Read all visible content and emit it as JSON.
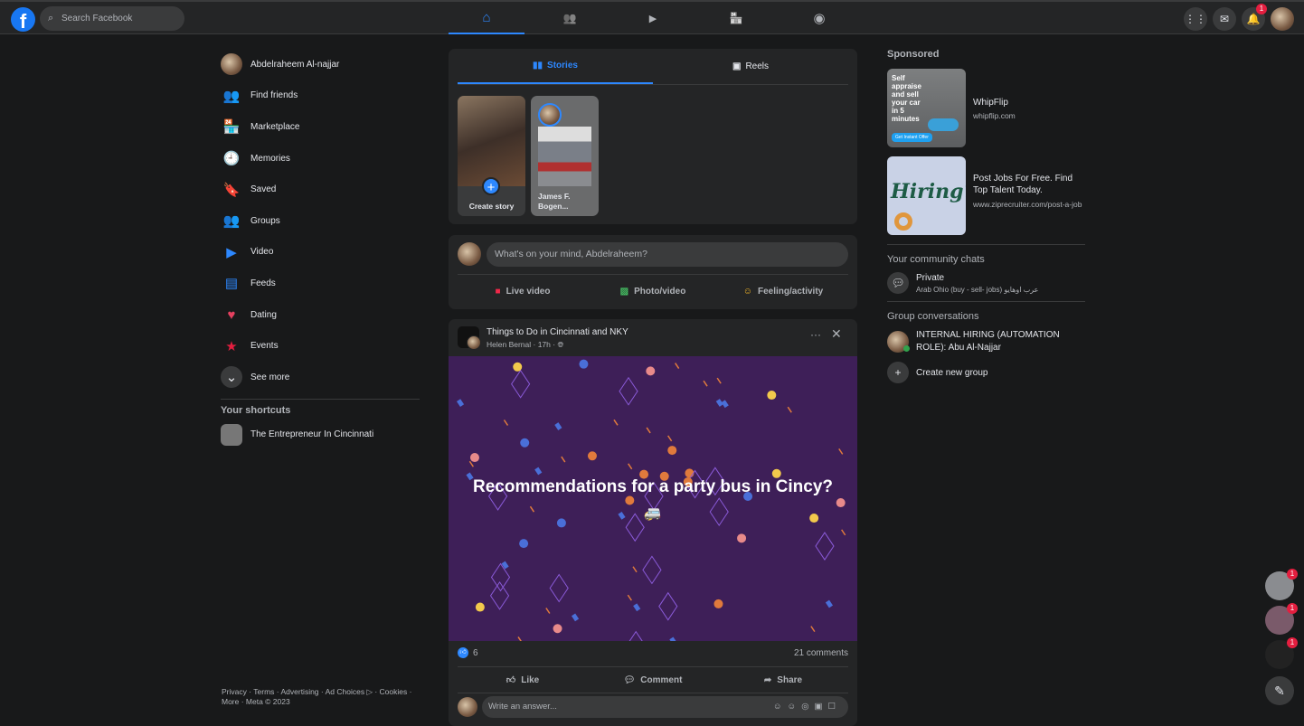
{
  "topbar": {
    "logo": "f",
    "search_placeholder": "Search Facebook",
    "nav": [
      {
        "name": "home",
        "icon": "⌂"
      },
      {
        "name": "friends",
        "icon": "👥"
      },
      {
        "name": "watch",
        "icon": "▶"
      },
      {
        "name": "marketplace",
        "icon": "🏪"
      },
      {
        "name": "groups",
        "icon": "◉"
      }
    ],
    "notifications_badge": "1"
  },
  "sidebar": {
    "profile": "Abdelraheem Al-najjar",
    "items": [
      {
        "label": "Find friends",
        "icon": "👥",
        "color": "#2d88ff"
      },
      {
        "label": "Marketplace",
        "icon": "🏪",
        "color": "#2d88ff"
      },
      {
        "label": "Memories",
        "icon": "🕘",
        "color": "#2d88ff"
      },
      {
        "label": "Saved",
        "icon": "🔖",
        "color": "#a033ff"
      },
      {
        "label": "Groups",
        "icon": "👥",
        "color": "#2d88ff"
      },
      {
        "label": "Video",
        "icon": "▶",
        "color": "#2d88ff"
      },
      {
        "label": "Feeds",
        "icon": "▤",
        "color": "#2d88ff"
      },
      {
        "label": "Dating",
        "icon": "♥",
        "color": "#e4405f"
      },
      {
        "label": "Events",
        "icon": "★",
        "color": "#e41e3f"
      },
      {
        "label": "See more",
        "icon": "⌄",
        "color": "#3a3b3c"
      }
    ],
    "shortcuts_title": "Your shortcuts",
    "shortcuts": [
      "The Entrepreneur In Cincinnati"
    ],
    "footer": "Privacy · Terms · Advertising · Ad Choices ▷ · Cookies · More · Meta © 2023"
  },
  "stories": {
    "tabs": [
      "Stories",
      "Reels"
    ],
    "create_label": "Create story",
    "story_name": "James F. Bogen..."
  },
  "composer": {
    "placeholder": "What's on your mind, Abdelraheem?",
    "actions": [
      "Live video",
      "Photo/video",
      "Feeling/activity"
    ]
  },
  "post": {
    "group": "Things to Do in Cincinnati and NKY",
    "author": "Helen Bernal",
    "time": "17h",
    "text": "Recommendations for a party bus in Cincy?",
    "emoji": "🚐",
    "likes": "6",
    "comments": "21 comments",
    "actions": [
      "Like",
      "Comment",
      "Share"
    ],
    "reply_placeholder": "Write an answer..."
  },
  "right": {
    "sponsored": "Sponsored",
    "ads": [
      {
        "title": "WhipFlip",
        "url": "whipflip.com",
        "img_text": "Self appraise and sell your car in 5 minutes",
        "img_button": "Get Instant Offer"
      },
      {
        "title": "Post Jobs For Free. Find Top Talent Today.",
        "url": "www.ziprecruiter.com/post-a-job",
        "img_text": "Hiring?"
      }
    ],
    "community_title": "Your community chats",
    "community": {
      "name": "Private",
      "sub": "Arab Ohio (buy - sell- jobs) عرب اوهايو"
    },
    "groups_title": "Group conversations",
    "group_conv": "INTERNAL HIRING (AUTOMATION ROLE): Abu Al-Najjar",
    "create_group": "Create new group"
  },
  "floating": {
    "badges": [
      "1",
      "1",
      "1"
    ]
  }
}
